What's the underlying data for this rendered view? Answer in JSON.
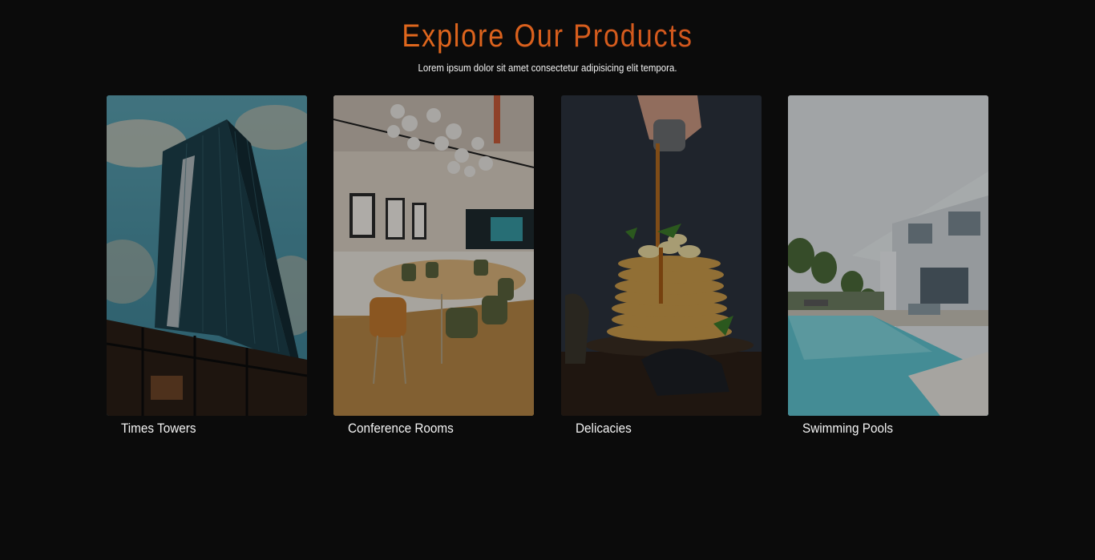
{
  "section": {
    "title": "Explore Our Products",
    "subtitle": "Lorem ipsum dolor sit amet consectetur adipisicing elit tempora."
  },
  "products": [
    {
      "label": "Times Towers"
    },
    {
      "label": "Conference Rooms"
    },
    {
      "label": "Delicacies"
    },
    {
      "label": "Swimming Pools"
    }
  ],
  "colors": {
    "background": "#0b0b0b",
    "title_gradient_start": "#f07a1c",
    "title_gradient_end": "#c1441e",
    "text": "#f4f4f4"
  }
}
